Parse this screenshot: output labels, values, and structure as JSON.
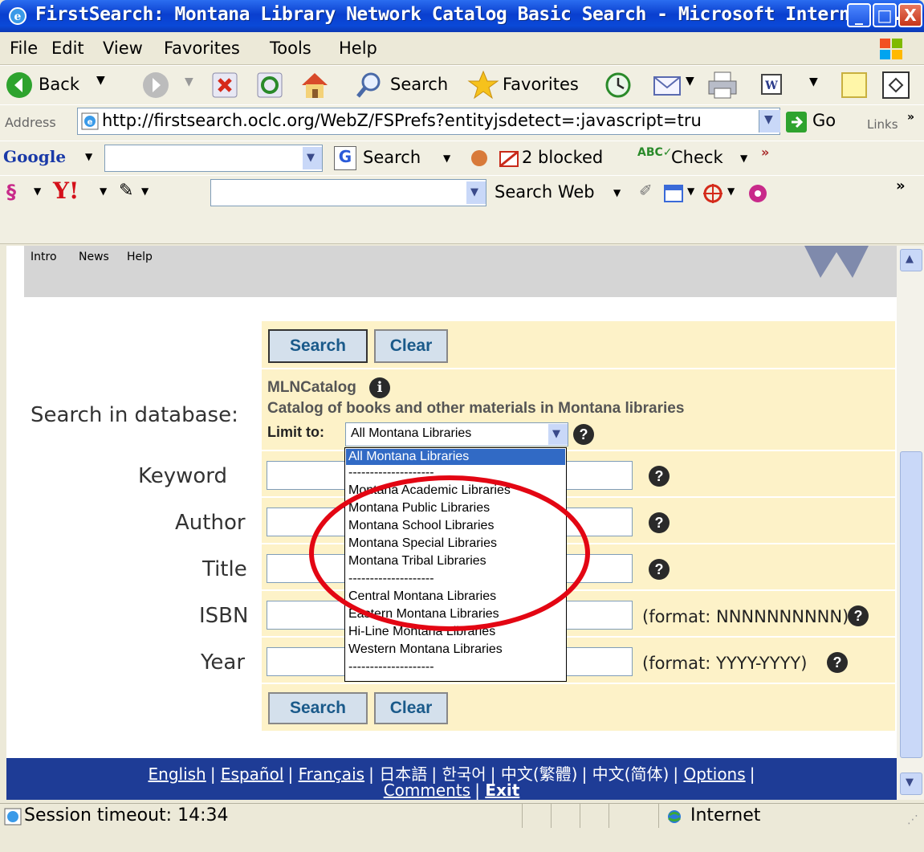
{
  "window": {
    "title": "FirstSearch: Montana Library Network Catalog Basic Search - Microsoft Internet...",
    "min": "_",
    "max": "□",
    "close": "X"
  },
  "menu": [
    "File",
    "Edit",
    "View",
    "Favorites",
    "Tools",
    "Help"
  ],
  "toolbar": {
    "back": "Back",
    "search": "Search",
    "favorites": "Favorites"
  },
  "address": {
    "label": "Address",
    "url": "http://firstsearch.oclc.org/WebZ/FSPrefs?entityjsdetect=:javascript=tru",
    "go": "Go",
    "links": "Links"
  },
  "google_bar": {
    "logo": "Google",
    "search": "Search",
    "blocked": "2 blocked",
    "check": "Check"
  },
  "yahoo_bar": {
    "logo": "Y!",
    "search_web": "Search Web"
  },
  "page_nav": [
    "Intro",
    "News",
    "Help"
  ],
  "form": {
    "search_label": "Search",
    "clear_label": "Clear",
    "database_label": "Search in database:",
    "db_name": "MLNCatalog",
    "db_desc": "Catalog of books and other materials in Montana libraries",
    "limit_label": "Limit to:",
    "limit_selected": "All Montana Libraries",
    "fields": [
      {
        "label": "Keyword",
        "format": ""
      },
      {
        "label": "Author",
        "format": ""
      },
      {
        "label": "Title",
        "format": ""
      },
      {
        "label": "ISBN",
        "format": "(format: NNNNNNNNNN)"
      },
      {
        "label": "Year",
        "format": "(format: YYYY-YYYY)"
      }
    ]
  },
  "dropdown_options": [
    "All Montana Libraries",
    "--------------------",
    "Montana Academic Libraries",
    "Montana Public Libraries",
    "Montana School Libraries",
    "Montana Special Libraries",
    "Montana Tribal Libraries",
    "--------------------",
    "Central Montana Libraries",
    "Eastern Montana Libraries",
    "Hi-Line Montana Libraries",
    "Western Montana Libraries",
    "--------------------"
  ],
  "footer": {
    "languages": [
      "English",
      "Español",
      "Français",
      "日本語",
      "한국어",
      "中文(繁體)",
      "中文(简体)"
    ],
    "options": "Options",
    "comments": "Comments",
    "exit": "Exit"
  },
  "status": {
    "text": "Session timeout: 14:34",
    "zone": "Internet"
  },
  "colors": {
    "highlight": "#e30613",
    "footer": "#1e3c96",
    "cell": "#fdf2c8",
    "selected": "#316ac5"
  }
}
